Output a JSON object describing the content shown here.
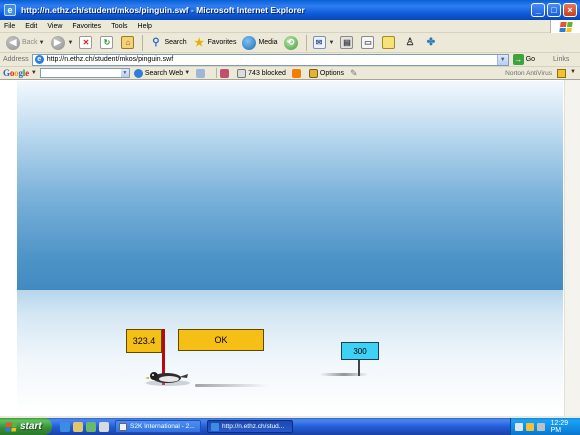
{
  "window": {
    "title": "http://n.ethz.ch/student/mkos/pinguin.swf - Microsoft Internet Explorer",
    "minimize": "_",
    "maximize": "□",
    "close": "×"
  },
  "menu": [
    "File",
    "Edit",
    "View",
    "Favorites",
    "Tools",
    "Help"
  ],
  "toolbar": {
    "back": "Back",
    "search": "Search",
    "favorites": "Favorites",
    "media": "Media"
  },
  "address": {
    "label": "Address",
    "url": "http://n.ethz.ch/student/mkos/pinguin.swf",
    "go": "Go",
    "links": "Links"
  },
  "google_bar": {
    "logo": "Google",
    "search_web": "Search Web",
    "blocked": "743 blocked",
    "options": "Options",
    "norton": "Norton AntiVirus"
  },
  "game": {
    "distance": "323.4",
    "ok_label": "OK",
    "target": "300"
  },
  "taskbar": {
    "start": "start",
    "tasks": [
      {
        "label": "S2K International - 2..."
      },
      {
        "label": "http://n.ethz.ch/stud..."
      }
    ],
    "clock": "12:29 PM"
  },
  "colors": {
    "sign_yellow": "#f5bf16",
    "sign_cyan": "#3dd1f5",
    "pole_red": "#b70a0a",
    "sky_blue": "#418ac1"
  }
}
